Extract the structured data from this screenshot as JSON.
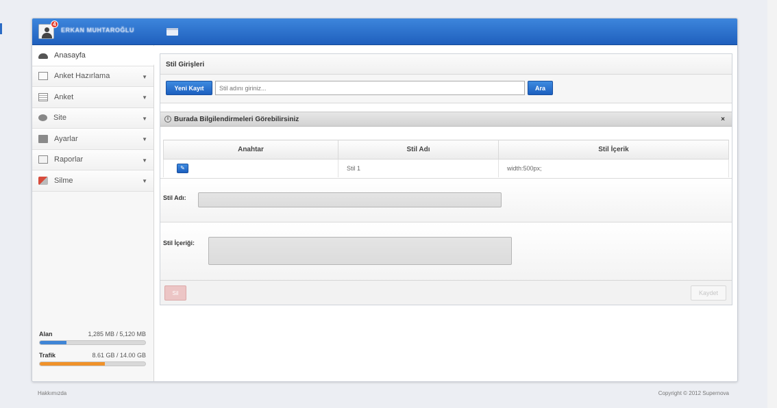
{
  "header": {
    "username": "ERKAN MUHTAROĞLU",
    "notification_count": "4"
  },
  "sidebar": {
    "items": [
      {
        "label": "Anasayfa",
        "icon": "home-icon",
        "active": true
      },
      {
        "label": "Anket Hazırlama",
        "icon": "document-icon",
        "arrow": "▼"
      },
      {
        "label": "Anket",
        "icon": "list-icon",
        "arrow": "▼"
      },
      {
        "label": "Site",
        "icon": "site-icon",
        "arrow": "▼"
      },
      {
        "label": "Ayarlar",
        "icon": "settings-icon",
        "arrow": "▼"
      },
      {
        "label": "Raporlar",
        "icon": "report-icon",
        "arrow": "▼"
      },
      {
        "label": "Silme",
        "icon": "delete-icon",
        "arrow": "▼"
      }
    ],
    "usage": {
      "alan": {
        "label": "Alan",
        "value": "1,285 MB / 5,120 MB",
        "fraction": 0.25,
        "color": "#3f85d6"
      },
      "trafik": {
        "label": "Trafik",
        "value": "8.61 GB / 14.00 GB",
        "fraction": 0.615,
        "color": "#f0922a"
      }
    }
  },
  "main": {
    "panel_title": "Stil Girişleri",
    "new_record_button": "Yeni Kayıt",
    "search_placeholder": "Stil adını giriniz...",
    "search_button": "Ara",
    "info_bar_text": "Burada Bilgilendirmeleri Görebilirsiniz",
    "info_close": "×",
    "table": {
      "headers": [
        "Anahtar",
        "Stil Adı",
        "Stil İçerik"
      ],
      "rows": [
        {
          "name": "Stil 1",
          "content": "width:500px;"
        }
      ]
    },
    "form": {
      "name_label": "Stil Adı:",
      "content_label": "Stil İçeriği:"
    },
    "delete_button": "Sil",
    "save_button": "Kaydet"
  },
  "footer": {
    "about": "Hakkımızda",
    "copyright": "Copyright © 2012 Supernova"
  }
}
